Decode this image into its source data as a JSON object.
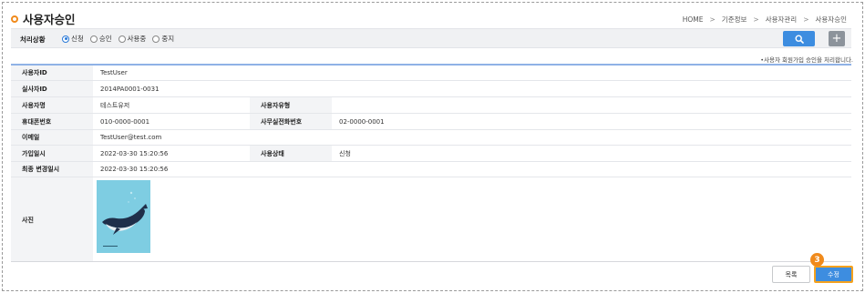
{
  "page": {
    "title": "사용자승인"
  },
  "breadcrumb": [
    "HOME",
    "기준정보",
    "사용자관리",
    "사용자승인"
  ],
  "filter": {
    "label": "처리상황",
    "options": [
      {
        "label": "신청",
        "selected": true
      },
      {
        "label": "승인",
        "selected": false
      },
      {
        "label": "사용중",
        "selected": false
      },
      {
        "label": "중지",
        "selected": false
      }
    ],
    "search_icon": "search-icon",
    "add_label": "+"
  },
  "note": "•사용자 회원가입 승인을 처리합니다.",
  "fields": {
    "user_id": {
      "label": "사용자ID",
      "value": "TestUser"
    },
    "real_id": {
      "label": "실사자ID",
      "value": "2014PA0001-0031"
    },
    "user_name": {
      "label": "사용자명",
      "value": "테스트유저"
    },
    "user_type": {
      "label": "사용자유형",
      "value": ""
    },
    "mobile": {
      "label": "휴대폰번호",
      "value": "010-0000-0001"
    },
    "office_phone": {
      "label": "사무실전화번호",
      "value": "02-0000-0001"
    },
    "email": {
      "label": "이메일",
      "value": "TestUser@test.com"
    },
    "join_date": {
      "label": "가입일시",
      "value": "2022-03-30 15:20:56"
    },
    "status": {
      "label": "사용상태",
      "value": "신청"
    },
    "last_modified": {
      "label": "최종 변경일시",
      "value": "2022-03-30 15:20:56"
    },
    "photo": {
      "label": "사진"
    }
  },
  "buttons": {
    "list": "목록",
    "edit": "수정"
  },
  "step_badge": "3",
  "colors": {
    "accent": "#3d8de0",
    "highlight": "#f5a21e",
    "badge": "#f08a1c"
  }
}
